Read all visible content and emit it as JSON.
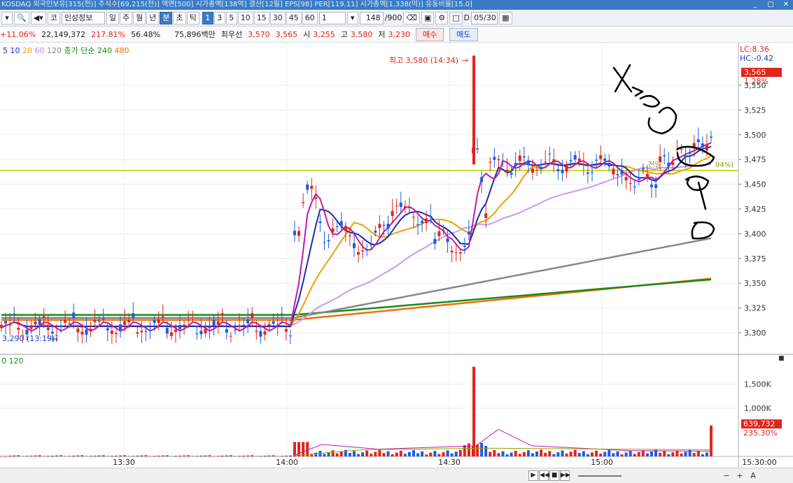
{
  "window": {
    "title": "KOSDAQ 외국인보유[315(전)] 주식수[69,215(전)] 액면[500] 시가총액[138억] 결산[12월] EPS[98] PER[119.11] 시가총액[1,338(억)] 유동비율[15.0]"
  },
  "toolbar": {
    "code_prefix": "코",
    "stock_name": "인성정보",
    "period_buttons": [
      "일",
      "주",
      "월",
      "년",
      "분",
      "초",
      "틱"
    ],
    "active_period": "분",
    "interval_buttons": [
      "1",
      "3",
      "5",
      "10",
      "15",
      "30",
      "45",
      "60"
    ],
    "active_interval": "1",
    "count_value": "1",
    "count_display": "148",
    "count_total": "/900",
    "date_prefix": "D",
    "date_value": "05/30"
  },
  "infobar": {
    "change_pct": "+11.06%",
    "volume": "22,149,372",
    "volume_ratio": "217.81%",
    "turnover": "56.48%",
    "amount": "75,896백만",
    "priority_label": "최우선",
    "bid1": "3,570",
    "ask1": "3,565",
    "open_label": "시",
    "open": "3,255",
    "high_label": "고",
    "high": "3,580",
    "low_label": "저",
    "low": "3,230",
    "buy_label": "매수",
    "sell_label": "매도"
  },
  "legend": {
    "items": [
      {
        "text": "5",
        "color": "#1a2fa8"
      },
      {
        "text": "10",
        "color": "#1a2fa8"
      },
      {
        "text": "20",
        "color": "#f0a000"
      },
      {
        "text": "60",
        "color": "#c080ff"
      },
      {
        "text": "120",
        "color": "#888888"
      },
      {
        "text": "종가 단순 240",
        "color": "#1a8a1a"
      },
      {
        "text": "480",
        "color": "#f07000"
      }
    ],
    "volume_legend": "0  120"
  },
  "annotations": {
    "max_label": "최고 3,580 (14:34)",
    "min_label": "3,290 (13:19)",
    "prev_close_label": "전일",
    "pct_label": "94%)",
    "lc": "LC:8.36",
    "hc": "HC:-0.42",
    "price_box": "3,565",
    "price_pct": "1.28%",
    "vol_box": "639,732",
    "vol_pct": "235.30%"
  },
  "colors": {
    "up": "#e0251c",
    "down": "#1a5ee0",
    "ma5": "#c01ab0",
    "ma10": "#1a2fa8",
    "ma20": "#f0a000",
    "ma60": "#c79bf5",
    "ma120": "#888888",
    "ma240": "#1a8a1a",
    "ma480": "#f07000",
    "prev_close_line": "#b8d000"
  },
  "chart_data": {
    "type": "candlestick",
    "interval": "1분",
    "price_axis": [
      3300,
      3325,
      3350,
      3375,
      3400,
      3425,
      3450,
      3475,
      3500,
      3525,
      3550
    ],
    "volume_axis": [
      "1,000K",
      "1,500K"
    ],
    "time_axis": [
      "13:30",
      "14:00",
      "14:30",
      "15:00",
      "15:30:00"
    ],
    "prev_close": 3464,
    "high": {
      "value": 3580,
      "time": "14:34"
    },
    "low": {
      "value": 3290,
      "time": "13:19"
    },
    "last_price": 3565
  },
  "status": {
    "scroll_buttons": [
      "▶",
      "◀◀",
      "■",
      "▶▶"
    ],
    "zoom_buttons": [
      "−",
      "+",
      "A"
    ]
  }
}
